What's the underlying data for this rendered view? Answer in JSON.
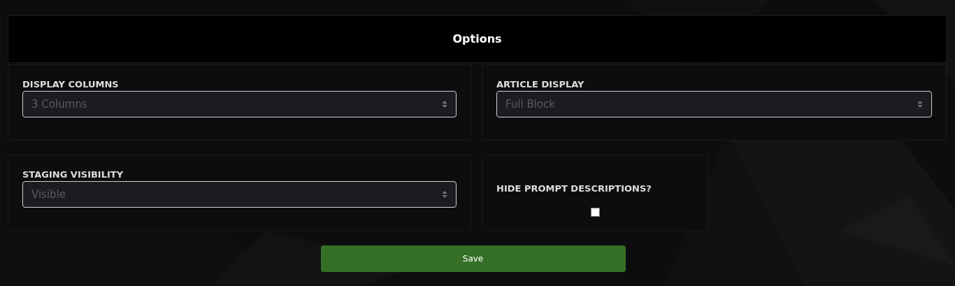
{
  "header": {
    "title": "Options"
  },
  "settings": [
    {
      "kind": "select",
      "label": "DISPLAY COLUMNS",
      "value": "3 Columns"
    },
    {
      "kind": "select",
      "label": "ARTICLE DISPLAY",
      "value": "Full Block"
    },
    {
      "kind": "select",
      "label": "STAGING VISIBILITY",
      "value": "Visible"
    },
    {
      "kind": "checkbox",
      "label": "HIDE PROMPT DESCRIPTIONS?",
      "checked": false
    }
  ],
  "save_button": {
    "label": "Save"
  }
}
